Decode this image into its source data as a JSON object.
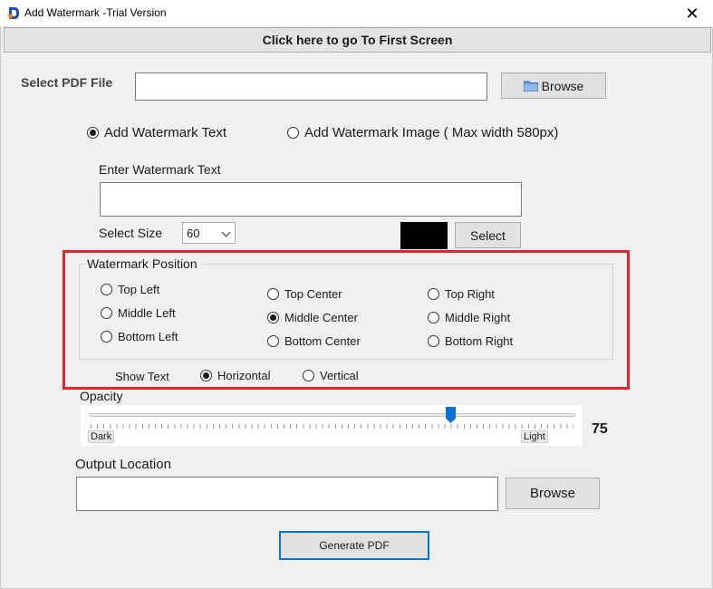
{
  "window": {
    "title": "Add Watermark  -Trial Version",
    "close_glyph": "✕",
    "icon": "app-logo-icon"
  },
  "top_button": "Click here to go To First Screen",
  "pdf": {
    "label": "Select PDF File",
    "value": "",
    "browse_label": "Browse",
    "browse_icon": "folder-icon"
  },
  "mode": {
    "text_option": "Add Watermark Text",
    "image_option": "Add Watermark Image ( Max width 580px)",
    "selected": "text"
  },
  "watermark_text": {
    "label": "Enter Watermark Text",
    "value": ""
  },
  "size": {
    "label": "Select Size",
    "value": "60"
  },
  "color": {
    "swatch": "#000000",
    "select_label": "Select"
  },
  "position": {
    "title": "Watermark Position",
    "options": [
      "Top Left",
      "Middle Left",
      "Bottom Left",
      "Top Center",
      "Middle Center",
      "Bottom Center",
      "Top Right",
      "Middle Right",
      "Bottom Right"
    ],
    "selected": "Middle Center"
  },
  "orientation": {
    "label": "Show Text",
    "horizontal": "Horizontal",
    "vertical": "Vertical",
    "selected": "Horizontal"
  },
  "opacity": {
    "label": "Opacity",
    "min_label": "Dark",
    "max_label": "Light",
    "value": "75",
    "fraction": 0.75
  },
  "output": {
    "label": "Output Location",
    "value": "",
    "browse_label": "Browse"
  },
  "generate_label": "Generate PDF",
  "colors": {
    "highlight": "#e0262c",
    "slider_thumb": "#0a6fd6",
    "background": "#f0f0f0"
  }
}
